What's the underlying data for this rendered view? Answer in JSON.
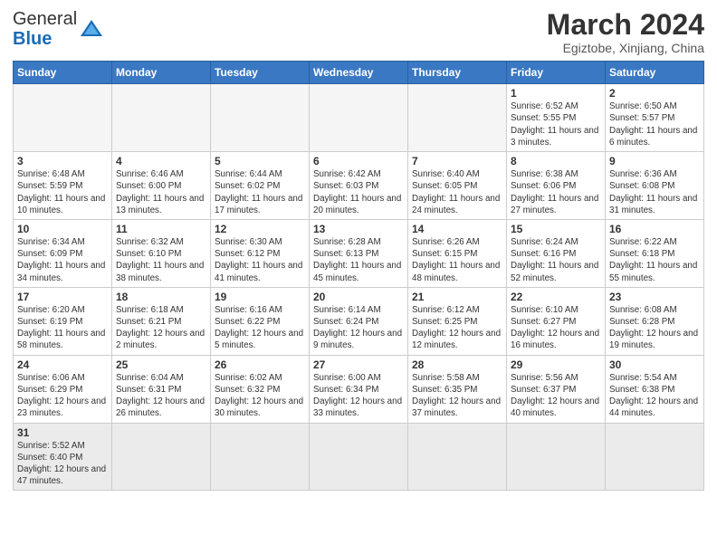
{
  "header": {
    "logo_general": "General",
    "logo_blue": "Blue",
    "month_title": "March 2024",
    "subtitle": "Egiztobe, Xinjiang, China"
  },
  "weekdays": [
    "Sunday",
    "Monday",
    "Tuesday",
    "Wednesday",
    "Thursday",
    "Friday",
    "Saturday"
  ],
  "weeks": [
    [
      {
        "day": "",
        "info": ""
      },
      {
        "day": "",
        "info": ""
      },
      {
        "day": "",
        "info": ""
      },
      {
        "day": "",
        "info": ""
      },
      {
        "day": "",
        "info": ""
      },
      {
        "day": "1",
        "info": "Sunrise: 6:52 AM\nSunset: 5:55 PM\nDaylight: 11 hours and 3 minutes."
      },
      {
        "day": "2",
        "info": "Sunrise: 6:50 AM\nSunset: 5:57 PM\nDaylight: 11 hours and 6 minutes."
      }
    ],
    [
      {
        "day": "3",
        "info": "Sunrise: 6:48 AM\nSunset: 5:59 PM\nDaylight: 11 hours and 10 minutes."
      },
      {
        "day": "4",
        "info": "Sunrise: 6:46 AM\nSunset: 6:00 PM\nDaylight: 11 hours and 13 minutes."
      },
      {
        "day": "5",
        "info": "Sunrise: 6:44 AM\nSunset: 6:02 PM\nDaylight: 11 hours and 17 minutes."
      },
      {
        "day": "6",
        "info": "Sunrise: 6:42 AM\nSunset: 6:03 PM\nDaylight: 11 hours and 20 minutes."
      },
      {
        "day": "7",
        "info": "Sunrise: 6:40 AM\nSunset: 6:05 PM\nDaylight: 11 hours and 24 minutes."
      },
      {
        "day": "8",
        "info": "Sunrise: 6:38 AM\nSunset: 6:06 PM\nDaylight: 11 hours and 27 minutes."
      },
      {
        "day": "9",
        "info": "Sunrise: 6:36 AM\nSunset: 6:08 PM\nDaylight: 11 hours and 31 minutes."
      }
    ],
    [
      {
        "day": "10",
        "info": "Sunrise: 6:34 AM\nSunset: 6:09 PM\nDaylight: 11 hours and 34 minutes."
      },
      {
        "day": "11",
        "info": "Sunrise: 6:32 AM\nSunset: 6:10 PM\nDaylight: 11 hours and 38 minutes."
      },
      {
        "day": "12",
        "info": "Sunrise: 6:30 AM\nSunset: 6:12 PM\nDaylight: 11 hours and 41 minutes."
      },
      {
        "day": "13",
        "info": "Sunrise: 6:28 AM\nSunset: 6:13 PM\nDaylight: 11 hours and 45 minutes."
      },
      {
        "day": "14",
        "info": "Sunrise: 6:26 AM\nSunset: 6:15 PM\nDaylight: 11 hours and 48 minutes."
      },
      {
        "day": "15",
        "info": "Sunrise: 6:24 AM\nSunset: 6:16 PM\nDaylight: 11 hours and 52 minutes."
      },
      {
        "day": "16",
        "info": "Sunrise: 6:22 AM\nSunset: 6:18 PM\nDaylight: 11 hours and 55 minutes."
      }
    ],
    [
      {
        "day": "17",
        "info": "Sunrise: 6:20 AM\nSunset: 6:19 PM\nDaylight: 11 hours and 58 minutes."
      },
      {
        "day": "18",
        "info": "Sunrise: 6:18 AM\nSunset: 6:21 PM\nDaylight: 12 hours and 2 minutes."
      },
      {
        "day": "19",
        "info": "Sunrise: 6:16 AM\nSunset: 6:22 PM\nDaylight: 12 hours and 5 minutes."
      },
      {
        "day": "20",
        "info": "Sunrise: 6:14 AM\nSunset: 6:24 PM\nDaylight: 12 hours and 9 minutes."
      },
      {
        "day": "21",
        "info": "Sunrise: 6:12 AM\nSunset: 6:25 PM\nDaylight: 12 hours and 12 minutes."
      },
      {
        "day": "22",
        "info": "Sunrise: 6:10 AM\nSunset: 6:27 PM\nDaylight: 12 hours and 16 minutes."
      },
      {
        "day": "23",
        "info": "Sunrise: 6:08 AM\nSunset: 6:28 PM\nDaylight: 12 hours and 19 minutes."
      }
    ],
    [
      {
        "day": "24",
        "info": "Sunrise: 6:06 AM\nSunset: 6:29 PM\nDaylight: 12 hours and 23 minutes."
      },
      {
        "day": "25",
        "info": "Sunrise: 6:04 AM\nSunset: 6:31 PM\nDaylight: 12 hours and 26 minutes."
      },
      {
        "day": "26",
        "info": "Sunrise: 6:02 AM\nSunset: 6:32 PM\nDaylight: 12 hours and 30 minutes."
      },
      {
        "day": "27",
        "info": "Sunrise: 6:00 AM\nSunset: 6:34 PM\nDaylight: 12 hours and 33 minutes."
      },
      {
        "day": "28",
        "info": "Sunrise: 5:58 AM\nSunset: 6:35 PM\nDaylight: 12 hours and 37 minutes."
      },
      {
        "day": "29",
        "info": "Sunrise: 5:56 AM\nSunset: 6:37 PM\nDaylight: 12 hours and 40 minutes."
      },
      {
        "day": "30",
        "info": "Sunrise: 5:54 AM\nSunset: 6:38 PM\nDaylight: 12 hours and 44 minutes."
      }
    ],
    [
      {
        "day": "31",
        "info": "Sunrise: 5:52 AM\nSunset: 6:40 PM\nDaylight: 12 hours and 47 minutes."
      },
      {
        "day": "",
        "info": ""
      },
      {
        "day": "",
        "info": ""
      },
      {
        "day": "",
        "info": ""
      },
      {
        "day": "",
        "info": ""
      },
      {
        "day": "",
        "info": ""
      },
      {
        "day": "",
        "info": ""
      }
    ]
  ]
}
